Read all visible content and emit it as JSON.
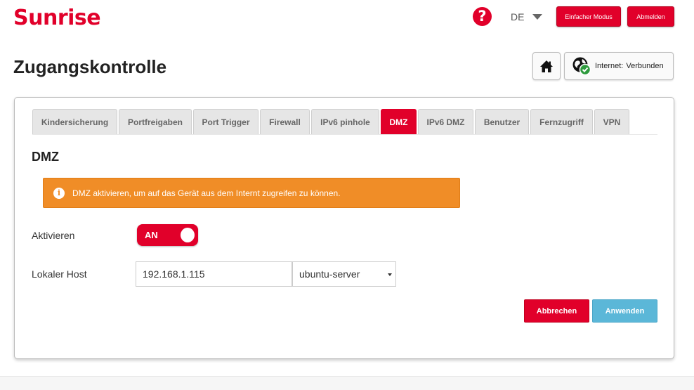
{
  "header": {
    "logo": "Sunrise",
    "language": "DE",
    "simple_mode_label": "Einfacher Modus",
    "logout_label": "Abmelden"
  },
  "page": {
    "title": "Zugangskontrolle",
    "internet_label": "Internet:",
    "internet_status": "Verbunden"
  },
  "tabs": [
    {
      "label": "Kindersicherung",
      "active": false
    },
    {
      "label": "Portfreigaben",
      "active": false
    },
    {
      "label": "Port Trigger",
      "active": false
    },
    {
      "label": "Firewall",
      "active": false
    },
    {
      "label": "IPv6 pinhole",
      "active": false
    },
    {
      "label": "DMZ",
      "active": true
    },
    {
      "label": "IPv6 DMZ",
      "active": false
    },
    {
      "label": "Benutzer",
      "active": false
    },
    {
      "label": "Fernzugriff",
      "active": false
    },
    {
      "label": "VPN",
      "active": false
    }
  ],
  "dmz": {
    "section_title": "DMZ",
    "alert_text": "DMZ aktivieren, um auf das Gerät aus dem Internt zugreifen zu können.",
    "enable_label": "Aktivieren",
    "toggle_state": "AN",
    "local_host_label": "Lokaler Host",
    "ip_value": "192.168.1.115",
    "host_selected": "ubuntu-server",
    "cancel_label": "Abbrechen",
    "apply_label": "Anwenden"
  },
  "colors": {
    "brand_red": "#e1002a",
    "alert_orange": "#f08d27",
    "apply_blue": "#5bb7d8"
  },
  "icons": [
    "help-icon",
    "chevron-down-icon",
    "home-icon",
    "globe-check-icon",
    "info-icon"
  ]
}
